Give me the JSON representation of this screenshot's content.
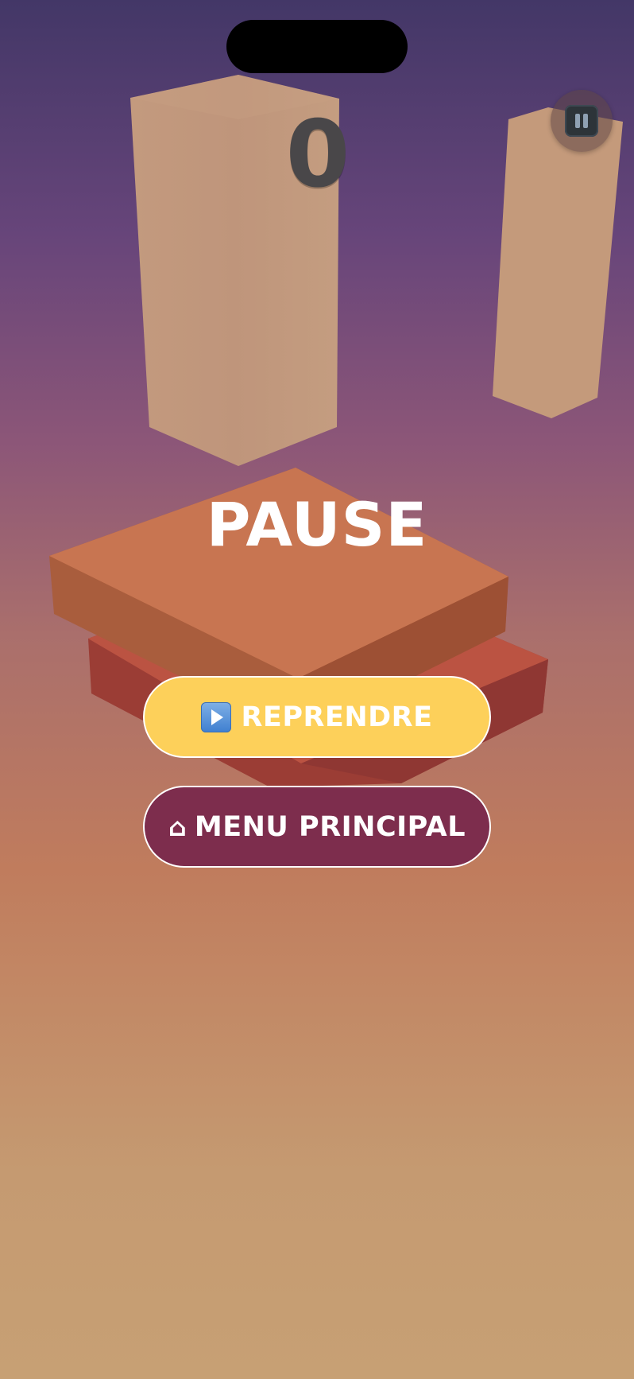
{
  "hud": {
    "score": "0",
    "pause_button_icon": "pause-icon"
  },
  "pause_menu": {
    "title": "PAUSE",
    "resume_label": "REPRENDRE",
    "resume_icon": "play-button-icon",
    "menu_label": "MENU PRINCIPAL",
    "menu_icon_glyph": "⌂",
    "menu_icon": "home-icon"
  },
  "colors": {
    "resume_button": "#fdd05a",
    "menu_button": "#7d2d4d",
    "score_text": "#494749",
    "pillar": "#c4997a",
    "top_block": "#c97550",
    "bottom_block": "#bb5240"
  }
}
